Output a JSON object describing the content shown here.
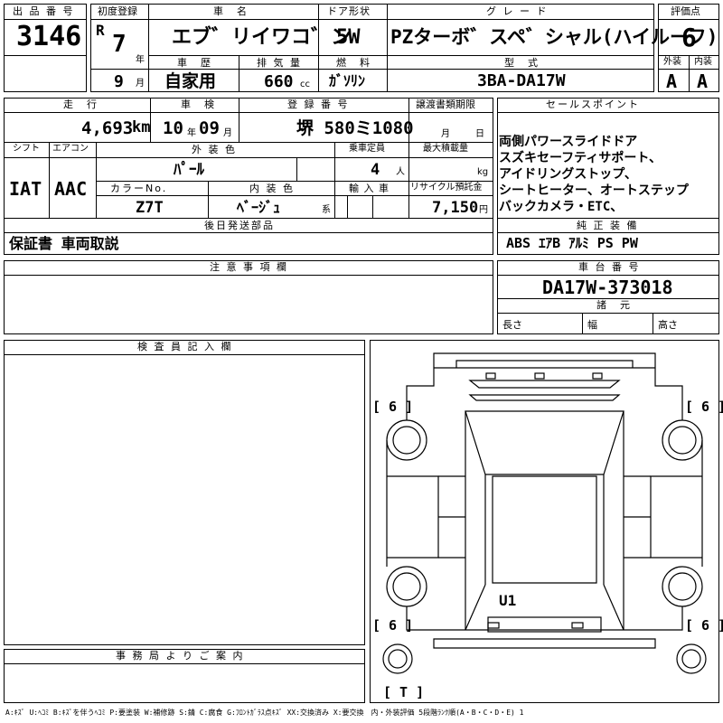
{
  "header": {
    "lot_label": "出 品 番 号",
    "lot_value": "3146",
    "first_reg_label": "初度登録",
    "era_letter": "R",
    "year_value": "7",
    "year_unit": "年",
    "month_value": "9",
    "month_unit": "月",
    "name_label": "車　名",
    "name_value": "エブ゛リイワコ゛ン",
    "door_label": "ドア形状",
    "door_value": "5W",
    "grade_label": "グ レ ー ド",
    "grade_value": "PZターボ゛スペ゛シャル(ハイルーフ)",
    "score_label": "評価点",
    "score_value": "6",
    "history_label": "車　歴",
    "history_value": "自家用",
    "displacement_label": "排 気 量",
    "displacement_value": "660",
    "displacement_unit": "cc",
    "fuel_label": "燃　料",
    "fuel_value": "ｶﾞｿﾘﾝ",
    "model_label": "型　式",
    "model_value": "3BA-DA17W",
    "exterior_label": "外装",
    "exterior_value": "A",
    "interior_label": "内装",
    "interior_value": "A"
  },
  "row2": {
    "mileage_label": "走　行",
    "mileage_value": "4,693",
    "mileage_unit": "km",
    "inspection_label": "車　検",
    "inspection_year": "10",
    "inspection_year_unit": "年",
    "inspection_month": "09",
    "inspection_month_unit": "月",
    "plate_label": "登 録 番 号",
    "plate_value": "堺 580ミ1080",
    "transfer_label": "譲渡書類期限",
    "transfer_month_unit": "月",
    "transfer_day_unit": "日",
    "shift_label": "シフト",
    "shift_value": "IAT",
    "ac_label": "エアコン",
    "ac_value": "AAC",
    "ext_color_label": "外 装 色",
    "ext_color_value": "ﾊﾟｰﾙ",
    "capacity_label": "乗車定員",
    "capacity_value": "4",
    "capacity_unit": "人",
    "load_label": "最大積載量",
    "load_unit": "kg",
    "color_no_label": "カラーNo.",
    "color_no_value": "Z7T",
    "int_color_label": "内 装 色",
    "int_color_value": "ﾍﾞｰｼﾞｭ",
    "int_color_unit": "系",
    "import_label": "輸 入 車",
    "recycle_label": "リサイクル預託金",
    "recycle_value": "7,150",
    "recycle_unit": "円",
    "later_parts_label": "後日発送部品",
    "later_parts_value": "保証書 車両取説"
  },
  "sales_points": {
    "label": "セールスポイント",
    "lines": [
      "両側パワースライドドア",
      "スズキセーフティサポート、",
      "アイドリングストップ、",
      "シートヒーター、オートステップ",
      "バックカメラ・ETC、"
    ]
  },
  "equipment": {
    "label": "純 正 装 備",
    "value": "ABS ｴｱB ｱﾙﾐ PS PW"
  },
  "notes": {
    "label": "注 意 事 項 欄"
  },
  "chassis": {
    "label": "車 台 番 号",
    "value": "DA17W-373018",
    "specs_label": "諸　元",
    "length_label": "長さ",
    "width_label": "幅",
    "height_label": "高さ"
  },
  "inspector": {
    "label": "検 査 員 記 入 欄"
  },
  "office": {
    "label": "事 務 局 よ り ご 案 内"
  },
  "diagram": {
    "tire_fl": "[ 6 ]",
    "tire_fr": "[ 6 ]",
    "tire_rl": "[ 6 ]",
    "tire_rr": "[ 6 ]",
    "spare": "[ T ]",
    "mark_u1": "U1"
  },
  "legend": "A:ｷｽﾞ U:ﾍｺﾐ B:ｷｽﾞを伴うﾍｺﾐ P:要塗装 W:補修跡 S:錆 C:腐食 G:ﾌﾛﾝﾄｶﾞﾗｽ点ｷｽﾞ XX:交換済み X:要交換　内・外装評価 5段階ﾗﾝｸ順(A・B・C・D・E) 1"
}
